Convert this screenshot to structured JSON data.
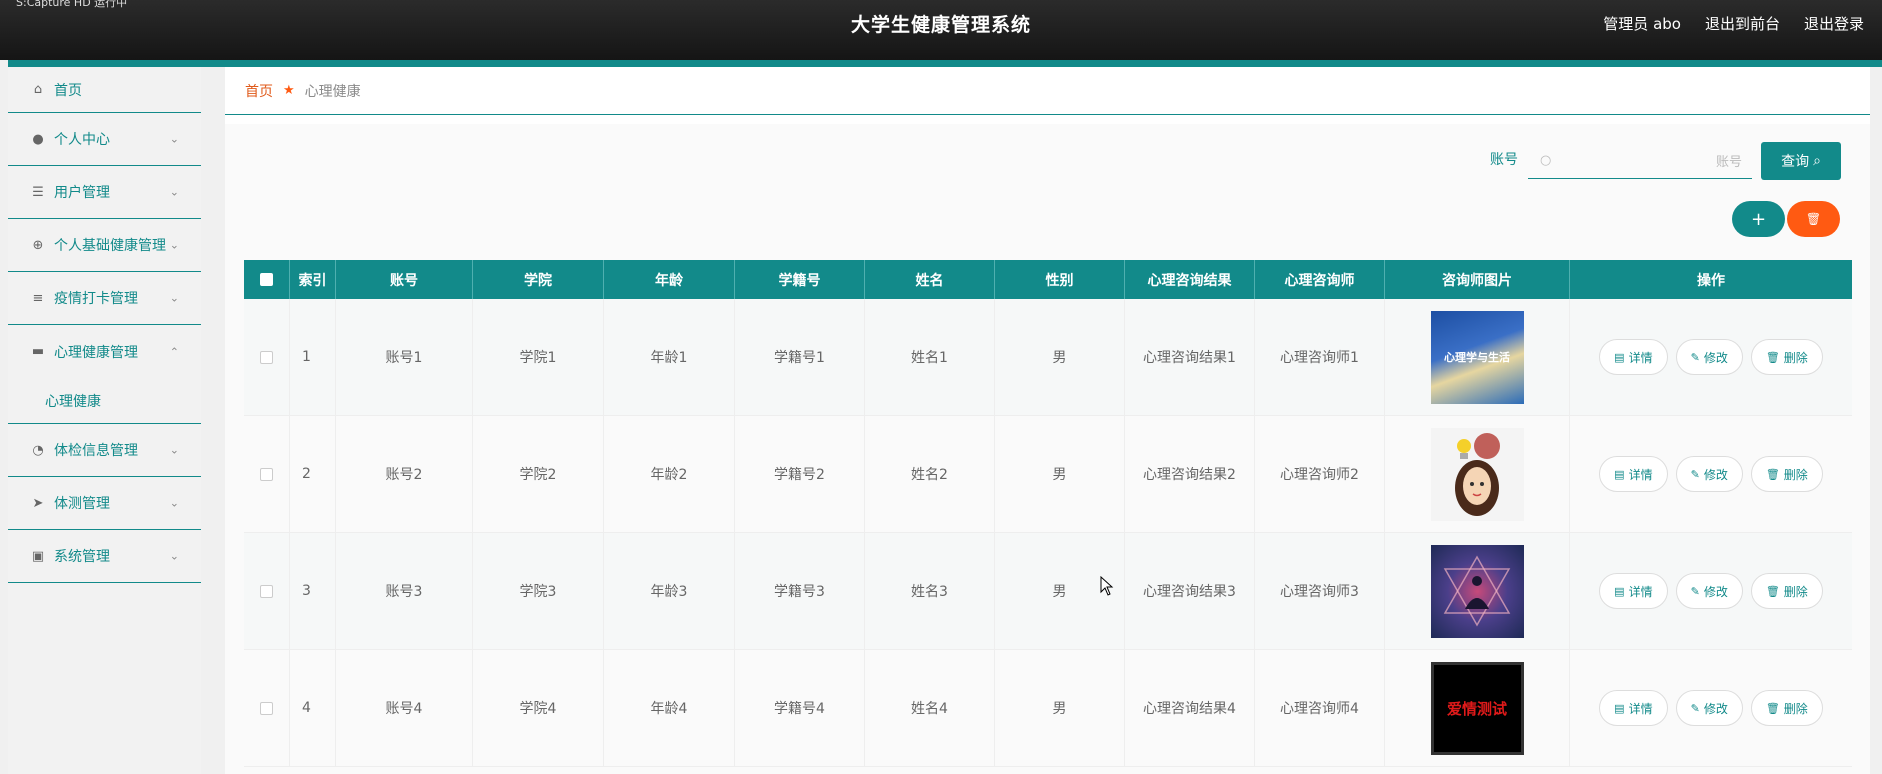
{
  "header": {
    "corner_text": "S:Capture HD 运行中",
    "title": "大学生健康管理系统",
    "user": "管理员 abo",
    "back_front": "退出到前台",
    "logout": "退出登录"
  },
  "sidebar": {
    "items": [
      {
        "label": "首页",
        "icon": "home-icon"
      },
      {
        "label": "个人中心",
        "icon": "user-icon"
      },
      {
        "label": "用户管理",
        "icon": "sliders-icon"
      },
      {
        "label": "个人基础健康管理",
        "icon": "crosshair-icon"
      },
      {
        "label": "疫情打卡管理",
        "icon": "list-icon"
      },
      {
        "label": "心理健康管理",
        "icon": "chat-icon",
        "sub": "心理健康"
      },
      {
        "label": "体检信息管理",
        "icon": "gauge-icon"
      },
      {
        "label": "体测管理",
        "icon": "send-icon"
      },
      {
        "label": "系统管理",
        "icon": "clipboard-icon"
      }
    ]
  },
  "breadcrumb": {
    "home": "首页",
    "current": "心理健康"
  },
  "search": {
    "label": "账号",
    "placeholder": "账号",
    "button": "查询"
  },
  "table": {
    "headers": [
      "索引",
      "账号",
      "学院",
      "年龄",
      "学籍号",
      "姓名",
      "性别",
      "心理咨询结果",
      "心理咨询师",
      "咨询师图片",
      "操作"
    ],
    "rows": [
      {
        "idx": "1",
        "account": "账号1",
        "college": "学院1",
        "age": "年龄1",
        "sid": "学籍号1",
        "name": "姓名1",
        "gender": "男",
        "result": "心理咨询结果1",
        "counselor": "心理咨询师1",
        "photo_text": "心理学与生活"
      },
      {
        "idx": "2",
        "account": "账号2",
        "college": "学院2",
        "age": "年龄2",
        "sid": "学籍号2",
        "name": "姓名2",
        "gender": "男",
        "result": "心理咨询结果2",
        "counselor": "心理咨询师2",
        "photo_text": ""
      },
      {
        "idx": "3",
        "account": "账号3",
        "college": "学院3",
        "age": "年龄3",
        "sid": "学籍号3",
        "name": "姓名3",
        "gender": "男",
        "result": "心理咨询结果3",
        "counselor": "心理咨询师3",
        "photo_text": ""
      },
      {
        "idx": "4",
        "account": "账号4",
        "college": "学院4",
        "age": "年龄4",
        "sid": "学籍号4",
        "name": "姓名4",
        "gender": "男",
        "result": "心理咨询结果4",
        "counselor": "心理咨询师4",
        "photo_text": "爱情测试"
      }
    ],
    "actions": {
      "detail": "详情",
      "edit": "修改",
      "delete": "删除"
    }
  },
  "colors": {
    "accent": "#128a8a",
    "danger": "#ff5a12",
    "header_bg": "#1f1f1f"
  }
}
